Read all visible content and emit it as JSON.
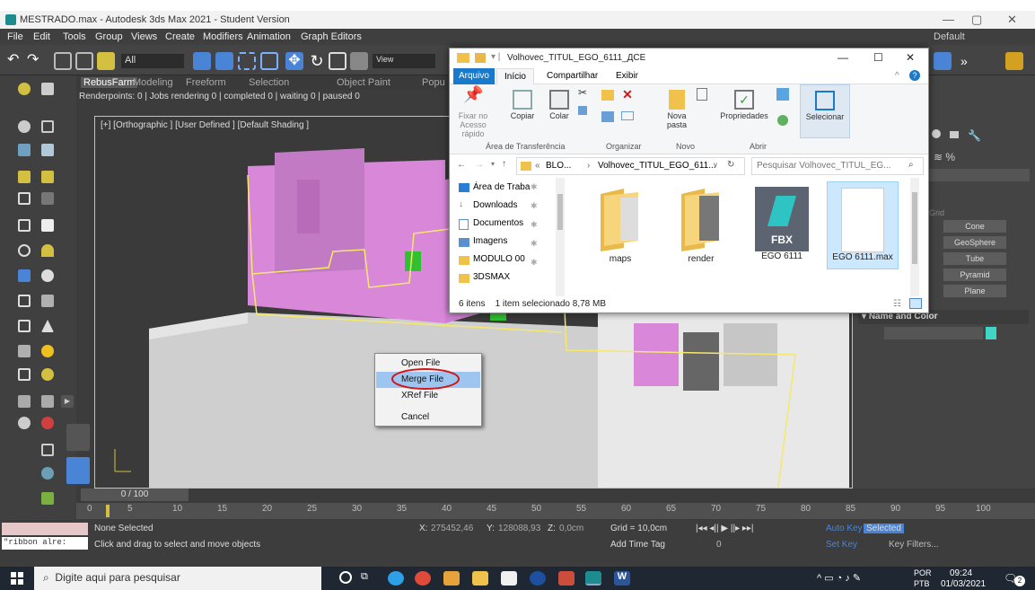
{
  "app": {
    "title": "MESTRADO.max - Autodesk 3ds Max 2021 - Student Version"
  },
  "menu": [
    "File",
    "Edit",
    "Tools",
    "Group",
    "Views",
    "Create",
    "Modifiers",
    "Animation",
    "Graph Editors"
  ],
  "toolbar": {
    "selection_filter": "All",
    "view_label": "View",
    "workspace": "Default"
  },
  "ribbon": {
    "tabs": [
      "RebusFarm",
      "Modeling",
      "Freeform",
      "Selection",
      "Object Paint",
      "Popu"
    ],
    "status": "Renderpoints: 0 | Jobs rendering 0 | completed 0 | waiting 0 | paused 0"
  },
  "viewport": {
    "label": "[+] [Orthographic ] [User Defined ] [Default Shading ]"
  },
  "command_panel": {
    "buttons": [
      "Cone",
      "GeoSphere",
      "Tube",
      "Pyramid",
      "Plane"
    ],
    "grid_label": "Grid",
    "rollout_title": "Name and Color"
  },
  "timeline": {
    "slider": "0 / 100",
    "ticks": [
      "0",
      "5",
      "10",
      "15",
      "20",
      "25",
      "30",
      "35",
      "40",
      "45",
      "50",
      "55",
      "60",
      "65",
      "70",
      "75",
      "80",
      "85",
      "90",
      "95",
      "100"
    ]
  },
  "status": {
    "selection": "None Selected",
    "prompt": "Click and drag to select and move objects",
    "script_box": "\"ribbon alre:",
    "x_label": "X:",
    "x_value": "275452,46",
    "y_label": "Y:",
    "y_value": "128088,93",
    "z_label": "Z:",
    "z_value": "0,0cm",
    "grid": "Grid = 10,0cm",
    "add_time_tag": "Add Time Tag",
    "frame_value": "0",
    "auto_key": "Auto Key",
    "set_key": "Set Key",
    "key_mode": "Selected",
    "key_filters": "Key Filters..."
  },
  "explorer": {
    "title": "Volhovec_TITUL_EGO_6111_ДСЕ",
    "tabs": [
      "Arquivo",
      "Início",
      "Compartilhar",
      "Exibir"
    ],
    "ribbon_items": {
      "pin": "Fixar no Acesso rápido",
      "copy": "Copiar",
      "paste": "Colar",
      "new_folder": "Nova pasta",
      "properties": "Propriedades",
      "select": "Selecionar"
    },
    "ribbon_groups": [
      "Área de Transferência",
      "Organizar",
      "Novo",
      "Abrir"
    ],
    "address": {
      "prefix": "«",
      "part1": "BLO...",
      "sep": "›",
      "part2": "Volhovec_TITUL_EGO_611...",
      "search_placeholder": "Pesquisar Volhovec_TITUL_EG..."
    },
    "nav": [
      "Área de Traba",
      "Downloads",
      "Documentos",
      "Imagens",
      "MODULO 00",
      "3DSMAX"
    ],
    "files": [
      {
        "name": "maps",
        "badge": ""
      },
      {
        "name": "render",
        "badge": ""
      },
      {
        "name": "EGO 6111",
        "badge": "FBX"
      },
      {
        "name": "EGO 6111.max",
        "badge": ""
      }
    ],
    "status": {
      "count": "6 itens",
      "selected": "1 item selecionado",
      "size": "8,78 MB"
    }
  },
  "context_menu": [
    "Open File",
    "Merge File",
    "XRef File",
    "Cancel"
  ],
  "taskbar": {
    "search_placeholder": "Digite aqui para pesquisar",
    "lang": "POR",
    "lang2": "PTB",
    "time": "09:24",
    "date": "01/03/2021",
    "notif_count": "2"
  }
}
